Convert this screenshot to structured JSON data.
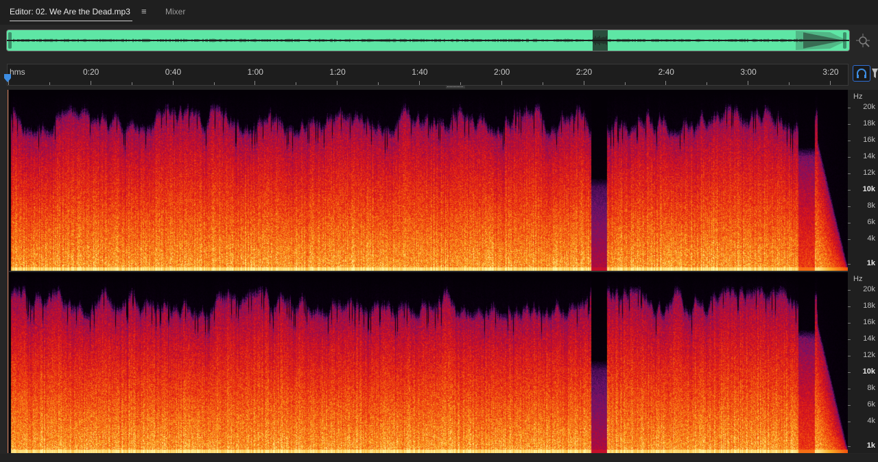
{
  "tabs": {
    "editor_label": "Editor: 02. We Are the Dead.mp3",
    "menu_glyph": "≡",
    "mixer_label": "Mixer"
  },
  "ruler": {
    "unit": "hms",
    "labels": [
      "0:20",
      "0:40",
      "1:00",
      "1:20",
      "1:40",
      "2:00",
      "2:20",
      "2:40",
      "3:00",
      "3:20"
    ]
  },
  "frequency_scale": {
    "unit": "Hz",
    "labels": [
      "20k",
      "18k",
      "16k",
      "14k",
      "12k",
      "10k",
      "8k",
      "6k",
      "4k",
      "1k"
    ]
  },
  "colors": {
    "overview_waveform": "#5ee6a5",
    "accent": "#2f6fd6",
    "playhead": "#3d8de3"
  },
  "icons": {
    "zoom": "zoom-to-selection-icon",
    "headphones": "headphones-icon",
    "filter": "funnel-icon",
    "playhead": "playhead-marker-icon"
  }
}
